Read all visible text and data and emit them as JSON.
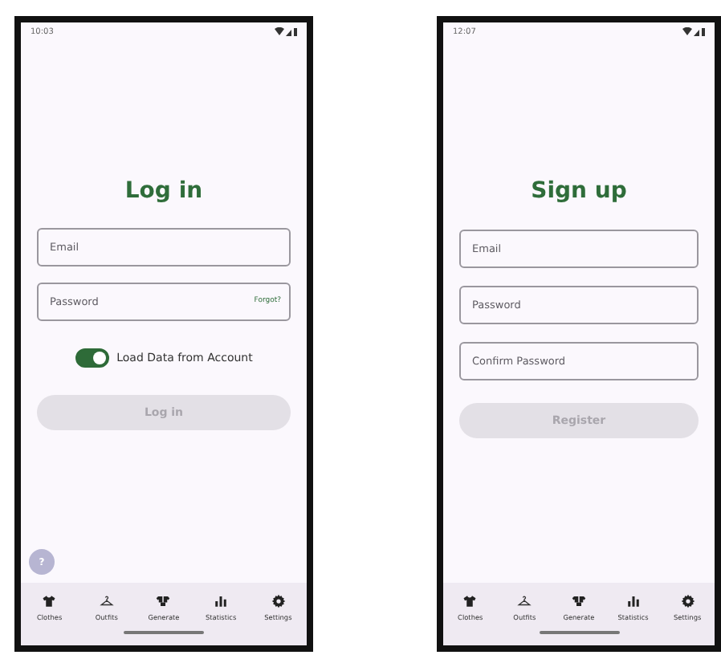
{
  "screens": [
    {
      "time": "10:03",
      "title": "Log in",
      "fields": [
        {
          "placeholder": "Email"
        },
        {
          "placeholder": "Password",
          "link": "Forgot?"
        }
      ],
      "toggle": {
        "label": "Load Data from Account",
        "on": true
      },
      "button": {
        "label": "Log in",
        "disabled": true
      },
      "help": {
        "label": "?"
      },
      "nav": [
        {
          "label": "Clothes"
        },
        {
          "label": "Outfits"
        },
        {
          "label": "Generate"
        },
        {
          "label": "Statistics"
        },
        {
          "label": "Settings"
        }
      ]
    },
    {
      "time": "12:07",
      "title": "Sign up",
      "fields": [
        {
          "placeholder": "Email"
        },
        {
          "placeholder": "Password"
        },
        {
          "placeholder": "Confirm Password"
        }
      ],
      "button": {
        "label": "Register",
        "disabled": true
      },
      "nav": [
        {
          "label": "Clothes"
        },
        {
          "label": "Outfits"
        },
        {
          "label": "Generate"
        },
        {
          "label": "Statistics"
        },
        {
          "label": "Settings"
        }
      ]
    }
  ]
}
